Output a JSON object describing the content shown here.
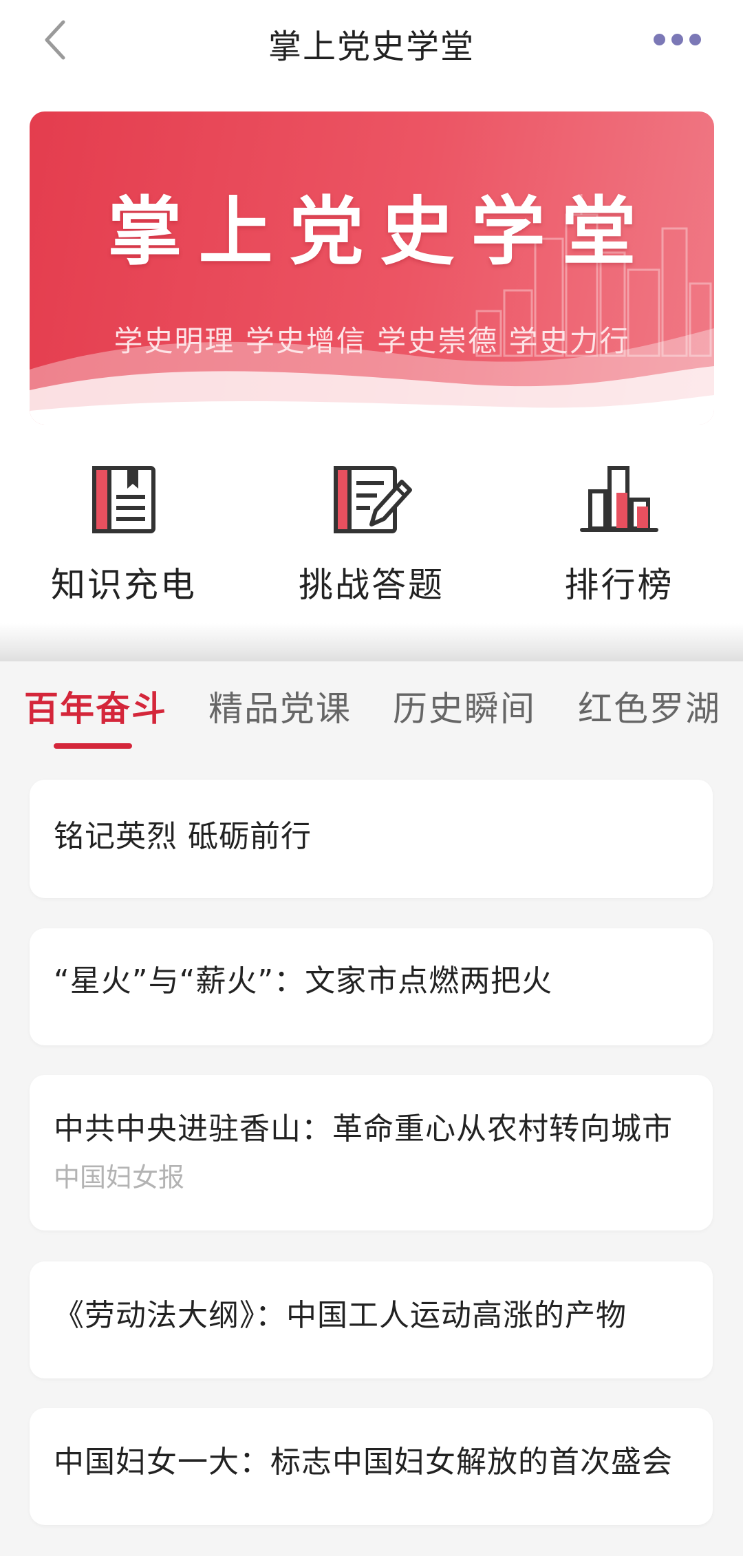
{
  "nav": {
    "title": "掌上党史学堂"
  },
  "banner": {
    "title": "掌上党史学堂",
    "subtitle": "学史明理 学史增信 学史崇德 学史力行"
  },
  "features": [
    {
      "label": "知识充电",
      "icon": "book-icon"
    },
    {
      "label": "挑战答题",
      "icon": "quiz-edit-icon"
    },
    {
      "label": "排行榜",
      "icon": "ranking-chart-icon"
    }
  ],
  "tabs": [
    {
      "label": "百年奋斗",
      "active": true
    },
    {
      "label": "精品党课",
      "active": false
    },
    {
      "label": "历史瞬间",
      "active": false
    },
    {
      "label": "红色罗湖",
      "active": false
    }
  ],
  "articles": [
    {
      "title": "铭记英烈 砥砺前行",
      "source": ""
    },
    {
      "title": "“星火”与“薪火”：文家市点燃两把火",
      "source": ""
    },
    {
      "title": "中共中央进驻香山：革命重心从农村转向城市",
      "source": "中国妇女报"
    },
    {
      "title": "《劳动法大纲》：中国工人运动高涨的产物",
      "source": ""
    },
    {
      "title": "中国妇女一大：标志中国妇女解放的首次盛会",
      "source": ""
    }
  ],
  "colors": {
    "accent": "#d4263a",
    "banner": "#e84857",
    "more_dots": "#7b78b6",
    "icon_stroke": "#333333",
    "icon_fill": "#e8505f"
  }
}
